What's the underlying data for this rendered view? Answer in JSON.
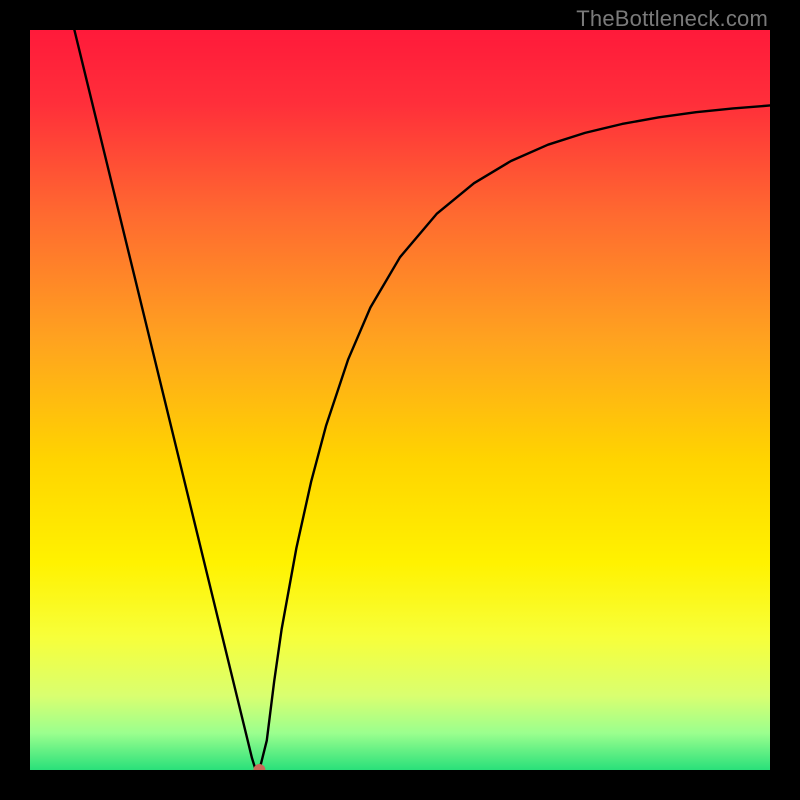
{
  "watermark": "TheBottleneck.com",
  "chart_data": {
    "type": "line",
    "title": "",
    "xlabel": "",
    "ylabel": "",
    "xlim": [
      0,
      1
    ],
    "ylim": [
      0,
      1
    ],
    "gradient_stops": [
      {
        "offset": 0.0,
        "color": "#ff1a3a"
      },
      {
        "offset": 0.1,
        "color": "#ff2f3a"
      },
      {
        "offset": 0.25,
        "color": "#ff6a30"
      },
      {
        "offset": 0.42,
        "color": "#ffa31f"
      },
      {
        "offset": 0.58,
        "color": "#ffd400"
      },
      {
        "offset": 0.72,
        "color": "#fff200"
      },
      {
        "offset": 0.82,
        "color": "#f7ff3a"
      },
      {
        "offset": 0.9,
        "color": "#d9ff70"
      },
      {
        "offset": 0.95,
        "color": "#9bff8e"
      },
      {
        "offset": 1.0,
        "color": "#29e07a"
      }
    ],
    "series": [
      {
        "name": "bottleneck-curve",
        "x": [
          0.06,
          0.08,
          0.1,
          0.12,
          0.14,
          0.16,
          0.18,
          0.2,
          0.22,
          0.24,
          0.26,
          0.28,
          0.3,
          0.305,
          0.31,
          0.32,
          0.33,
          0.34,
          0.36,
          0.38,
          0.4,
          0.43,
          0.46,
          0.5,
          0.55,
          0.6,
          0.65,
          0.7,
          0.75,
          0.8,
          0.85,
          0.9,
          0.95,
          1.0
        ],
        "y": [
          1.0,
          0.918,
          0.836,
          0.754,
          0.672,
          0.59,
          0.508,
          0.426,
          0.344,
          0.262,
          0.18,
          0.098,
          0.016,
          0.0,
          0.0,
          0.04,
          0.12,
          0.19,
          0.3,
          0.39,
          0.465,
          0.555,
          0.625,
          0.693,
          0.752,
          0.793,
          0.823,
          0.845,
          0.861,
          0.873,
          0.882,
          0.889,
          0.894,
          0.898
        ]
      }
    ],
    "marker": {
      "x": 0.31,
      "y": 0.0,
      "color": "#c96a5a",
      "r": 6
    }
  }
}
